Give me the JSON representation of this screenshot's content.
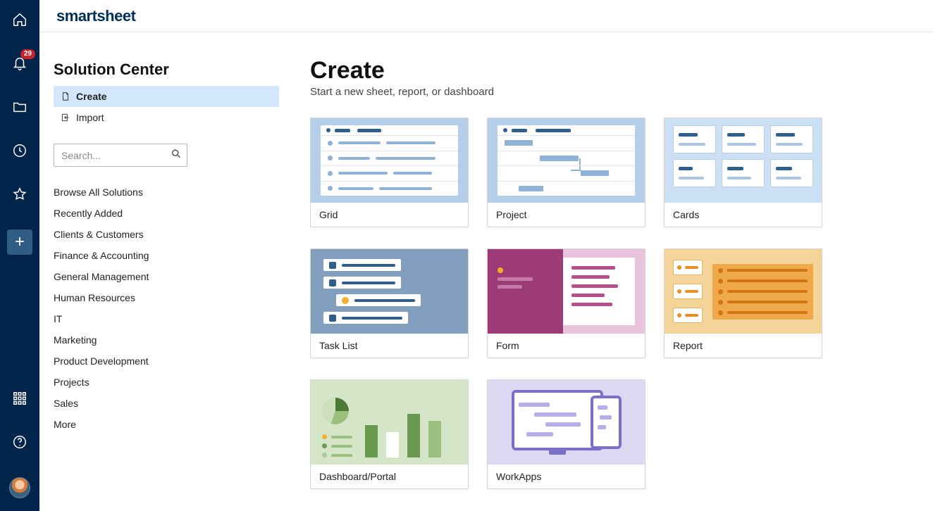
{
  "brand": "smartsheet",
  "rail": {
    "notifications_count": "29"
  },
  "sidebar": {
    "title": "Solution Center",
    "nav": {
      "create": "Create",
      "import": "Import"
    },
    "search_placeholder": "Search...",
    "categories": [
      "Browse All Solutions",
      "Recently Added",
      "Clients & Customers",
      "Finance & Accounting",
      "General Management",
      "Human Resources",
      "IT",
      "Marketing",
      "Product Development",
      "Projects",
      "Sales",
      "More"
    ]
  },
  "panel": {
    "heading": "Create",
    "subheading": "Start a new sheet, report, or dashboard",
    "cards": {
      "grid": "Grid",
      "project": "Project",
      "cards": "Cards",
      "tasklist": "Task List",
      "form": "Form",
      "report": "Report",
      "dashboard": "Dashboard/Portal",
      "workapps": "WorkApps"
    }
  }
}
